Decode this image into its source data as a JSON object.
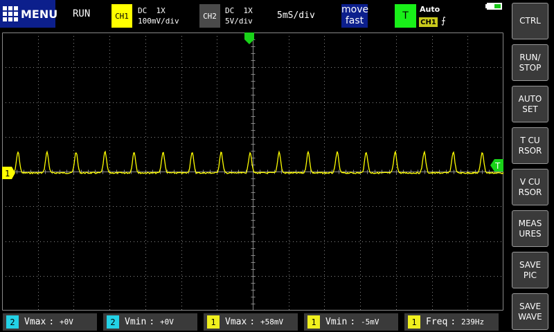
{
  "header": {
    "menu_label": "MENU",
    "run_state": "RUN",
    "ch1": {
      "badge": "CH1",
      "coupling": "DC  1X",
      "scale": "100mV/div"
    },
    "ch2": {
      "badge": "CH2",
      "coupling": "DC  1X",
      "scale": "5V/div"
    },
    "timebase": "5mS/div",
    "move_mode": [
      "move",
      "fast"
    ],
    "trigger": {
      "badge": "T",
      "mode": "Auto",
      "source": "CH1",
      "edge": "rising-edge-icon",
      "edge_glyph": "⨍"
    },
    "battery_level": 0.45
  },
  "screen": {
    "ch1_marker": "1",
    "trigger_marker": "T",
    "colors": {
      "ch1": "#ffff00",
      "grid": "#8a8a8a",
      "trigger": "#19d219"
    }
  },
  "right_panel": [
    {
      "label": "CTRL"
    },
    {
      "label": "RUN/\nSTOP"
    },
    {
      "label": "AUTO\nSET"
    },
    {
      "label": "T CU\nRSOR"
    },
    {
      "label": "V CU\nRSOR"
    },
    {
      "label": "MEAS\nURES"
    },
    {
      "label": "SAVE\nPIC"
    },
    {
      "label": "SAVE\nWAVE"
    }
  ],
  "measurements": [
    {
      "channel": "2",
      "label": "Vmax",
      "value": "+0V"
    },
    {
      "channel": "2",
      "label": "Vmin",
      "value": "+0V"
    },
    {
      "channel": "1",
      "label": "Vmax",
      "value": "+58mV"
    },
    {
      "channel": "1",
      "label": "Vmin",
      "value": "-5mV"
    },
    {
      "channel": "1",
      "label": "Freq",
      "value": "239Hz"
    }
  ]
}
